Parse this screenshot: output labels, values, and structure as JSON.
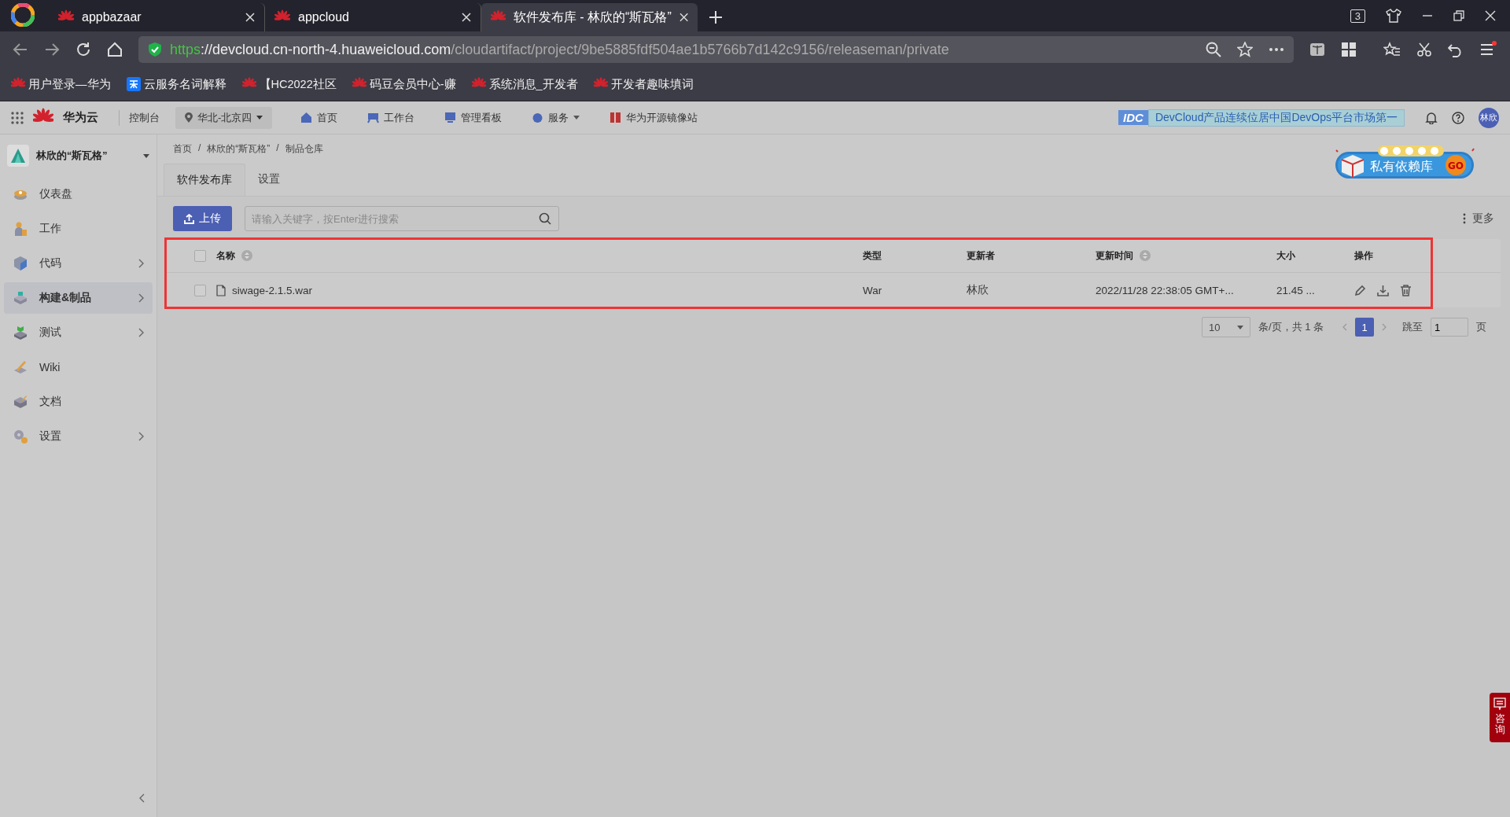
{
  "browser": {
    "tabs": [
      {
        "title": "appbazaar",
        "selected": false
      },
      {
        "title": "appcloud",
        "selected": false
      },
      {
        "title": "软件发布库 - 林欣的“斯瓦格”",
        "selected": true
      }
    ],
    "tab_count": "3",
    "url": {
      "scheme": "https",
      "host": "://devcloud.cn-north-4.huaweicloud.com",
      "path": "/cloudartifact/project/9be5885fdf504ae1b5766b7d142c9156/releaseman/private"
    },
    "bookmarks": [
      {
        "label": "用户登录—华为",
        "kind": "huawei"
      },
      {
        "label": "云服务名词解释",
        "kind": "zhihu"
      },
      {
        "label": "【HC2022社区",
        "kind": "huawei"
      },
      {
        "label": "码豆会员中心-赚",
        "kind": "huawei"
      },
      {
        "label": "系统消息_开发者",
        "kind": "huawei"
      },
      {
        "label": "开发者趣味填词",
        "kind": "huawei"
      }
    ]
  },
  "topnav": {
    "brand": "华为云",
    "console": "控制台",
    "region": "华北-北京四",
    "items": [
      {
        "label": "首页",
        "kind": "home"
      },
      {
        "label": "工作台",
        "kind": "desk"
      },
      {
        "label": "管理看板",
        "kind": "board"
      },
      {
        "label": "服务",
        "kind": "service",
        "dropdown": true
      },
      {
        "label": "华为开源镜像站",
        "kind": "mirror"
      }
    ],
    "banner": {
      "badge": "IDC",
      "text": "DevCloud产品连续位居中国DevOps平台市场第一"
    },
    "avatar": "林欣"
  },
  "sidebar": {
    "project": "林欣的“斯瓦格”",
    "items": [
      {
        "label": "仪表盘",
        "kind": "dashboard",
        "expandable": false,
        "selected": false
      },
      {
        "label": "工作",
        "kind": "work",
        "expandable": false,
        "selected": false
      },
      {
        "label": "代码",
        "kind": "code",
        "expandable": true,
        "selected": false
      },
      {
        "label": "构建&制品",
        "kind": "build",
        "expandable": true,
        "selected": true
      },
      {
        "label": "测试",
        "kind": "test",
        "expandable": true,
        "selected": false
      },
      {
        "label": "Wiki",
        "kind": "wiki",
        "expandable": false,
        "selected": false
      },
      {
        "label": "文档",
        "kind": "docs",
        "expandable": false,
        "selected": false
      },
      {
        "label": "设置",
        "kind": "settings",
        "expandable": true,
        "selected": false
      }
    ]
  },
  "breadcrumb": {
    "separator": "/",
    "items": [
      "首页",
      "林欣的“斯瓦格”",
      "制品仓库"
    ]
  },
  "tabs": [
    {
      "label": "软件发布库",
      "selected": true
    },
    {
      "label": "设置",
      "selected": false
    }
  ],
  "promo": {
    "text": "私有依赖库",
    "button": "GO"
  },
  "toolbar": {
    "upload": "上传",
    "search": {
      "placeholder": "请输入关键字，按Enter进行搜索"
    },
    "more": "更多"
  },
  "table": {
    "highlighted": true,
    "select_all": false,
    "columns": [
      {
        "label": "名称",
        "sortable": true
      },
      {
        "label": "类型",
        "sortable": false
      },
      {
        "label": "更新者",
        "sortable": false
      },
      {
        "label": "更新时间",
        "sortable": true
      },
      {
        "label": "大小",
        "sortable": false
      },
      {
        "label": "操作",
        "sortable": false
      }
    ],
    "rows": [
      {
        "checked": false,
        "name": "siwage-2.1.5.war",
        "type": "War",
        "updater": "林欣",
        "time": "2022/11/28 22:38:05 GMT+...",
        "size": "21.45 ..."
      }
    ]
  },
  "pagination": {
    "page_size": "10",
    "summary": "条/页，共 1 条",
    "pages": [
      {
        "label": "1",
        "selected": true
      }
    ],
    "jump_label": "跳至",
    "jump_value": "1",
    "unit": "页"
  },
  "consult": "咨询"
}
